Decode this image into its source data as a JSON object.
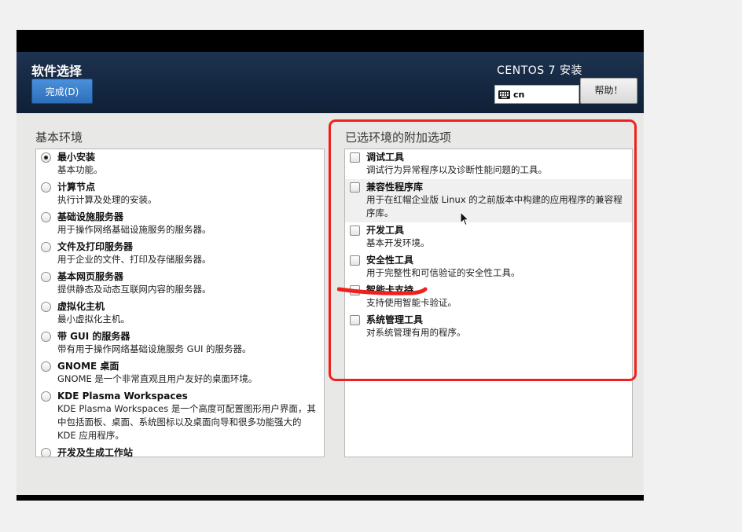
{
  "header": {
    "page_title": "软件选择",
    "done_label": "完成(D)",
    "product_title": "CENTOS 7 安装",
    "keyboard_layout": "cn",
    "help_label": "帮助！"
  },
  "environments": {
    "heading": "基本环境",
    "items": [
      {
        "title": "最小安装",
        "desc": "基本功能。",
        "selected": true
      },
      {
        "title": "计算节点",
        "desc": "执行计算及处理的安装。",
        "selected": false
      },
      {
        "title": "基础设施服务器",
        "desc": "用于操作网络基础设施服务的服务器。",
        "selected": false
      },
      {
        "title": "文件及打印服务器",
        "desc": "用于企业的文件、打印及存储服务器。",
        "selected": false
      },
      {
        "title": "基本网页服务器",
        "desc": "提供静态及动态互联网内容的服务器。",
        "selected": false
      },
      {
        "title": "虚拟化主机",
        "desc": "最小虚拟化主机。",
        "selected": false
      },
      {
        "title": "带 GUI 的服务器",
        "desc": "带有用于操作网络基础设施服务 GUI 的服务器。",
        "selected": false
      },
      {
        "title": "GNOME 桌面",
        "desc": "GNOME 是一个非常直观且用户友好的桌面环境。",
        "selected": false
      },
      {
        "title": "KDE Plasma Workspaces",
        "desc": "KDE Plasma Workspaces 是一个高度可配置图形用户界面，其中包括面板、桌面、系统图标以及桌面向导和很多功能强大的 KDE 应用程序。",
        "selected": false
      },
      {
        "title": "开发及生成工作站",
        "desc": "",
        "selected": false
      }
    ]
  },
  "addons": {
    "heading": "已选环境的附加选项",
    "items": [
      {
        "title": "调试工具",
        "desc": "调试行为异常程序以及诊断性能问题的工具。",
        "checked": false
      },
      {
        "title": "兼容性程序库",
        "desc": "用于在红帽企业版 Linux 的之前版本中构建的应用程序的兼容程序库。",
        "checked": false
      },
      {
        "title": "开发工具",
        "desc": "基本开发环境。",
        "checked": false
      },
      {
        "title": "安全性工具",
        "desc": "用于完整性和可信验证的安全性工具。",
        "checked": false
      },
      {
        "title": "智能卡支持",
        "desc": "支持使用智能卡验证。",
        "checked": false
      },
      {
        "title": "系统管理工具",
        "desc": "对系统管理有用的程序。",
        "checked": false
      }
    ]
  },
  "colors": {
    "header_bg": "#152842",
    "done_button": "#2e6fba",
    "annotation_red": "#f0211d"
  }
}
